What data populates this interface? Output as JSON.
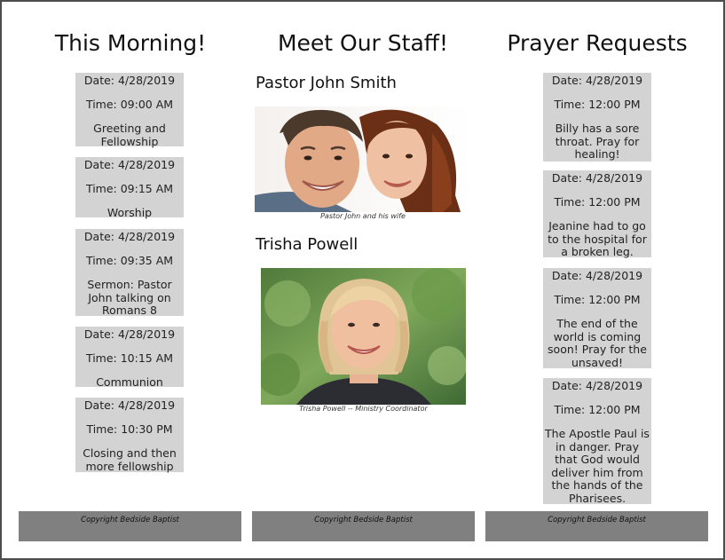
{
  "columns": {
    "left_title": "This Morning!",
    "middle_title": "Meet Our Staff!",
    "right_title": "Prayer Requests"
  },
  "schedule": [
    {
      "date": "Date: 4/28/2019",
      "time": "Time: 09:00 AM",
      "event": "Greeting and Fellowship"
    },
    {
      "date": "Date: 4/28/2019",
      "time": "Time: 09:15 AM",
      "event": "Worship"
    },
    {
      "date": "Date: 4/28/2019",
      "time": "Time: 09:35 AM",
      "event": "Sermon: Pastor John talking on Romans 8"
    },
    {
      "date": "Date: 4/28/2019",
      "time": "Time: 10:15 AM",
      "event": "Communion"
    },
    {
      "date": "Date: 4/28/2019",
      "time": "Time: 10:30 PM",
      "event": "Closing and then more fellowship"
    }
  ],
  "staff": [
    {
      "name": "Pastor John Smith",
      "caption": "Pastor John and his wife"
    },
    {
      "name": "Trisha Powell",
      "caption": "Trisha Powell -- Ministry Coordinator"
    }
  ],
  "prayers": [
    {
      "date": "Date: 4/28/2019",
      "time": "Time: 12:00 PM",
      "text": "Billy has a sore throat. Pray for healing!"
    },
    {
      "date": "Date: 4/28/2019",
      "time": "Time: 12:00 PM",
      "text": "Jeanine had to go to the hospital for a broken leg."
    },
    {
      "date": "Date: 4/28/2019",
      "time": "Time: 12:00 PM",
      "text": "The end of the world is coming soon! Pray for the unsaved!"
    },
    {
      "date": "Date: 4/28/2019",
      "time": "Time: 12:00 PM",
      "text": "The Apostle Paul is in danger. Pray that God would deliver him from the hands of the Pharisees."
    }
  ],
  "footer": {
    "left": "Copyright Bedside Baptist",
    "middle": "Copyright Bedside Baptist",
    "right": "Copyright Bedside Baptist"
  }
}
